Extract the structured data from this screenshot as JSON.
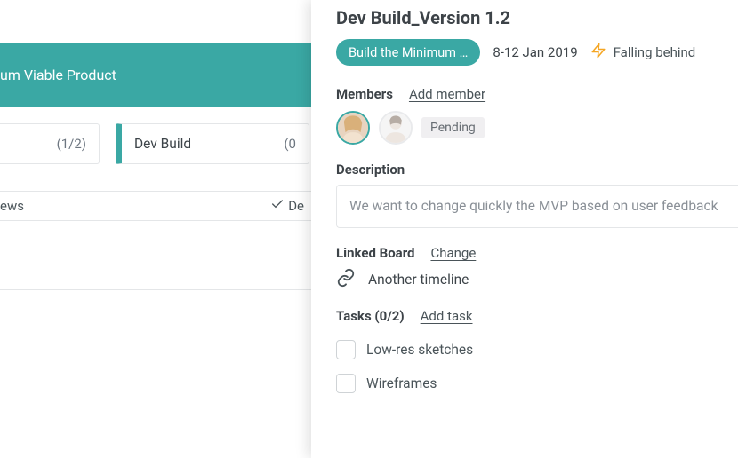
{
  "left": {
    "banner": "um Viable Product",
    "tab1_count": "(1/2)",
    "tab2_label": "Dev Build",
    "tab2_count": "(0",
    "subtask_label": "ews",
    "subtask_check_suffix": "De"
  },
  "panel": {
    "title": "Dev Build_Version 1.2",
    "pill": "Build the Minimum …",
    "date": "8-12 Jan 2019",
    "status": "Falling behind"
  },
  "members": {
    "label": "Members",
    "action": "Add member",
    "pending": "Pending"
  },
  "description": {
    "label": "Description",
    "text": "We want to change quickly the MVP based on user feedback"
  },
  "linked": {
    "label": "Linked Board",
    "action": "Change",
    "name": "Another timeline"
  },
  "tasks": {
    "label": "Tasks (0/2)",
    "action": "Add task",
    "items": [
      "Low-res sketches",
      "Wireframes"
    ]
  }
}
